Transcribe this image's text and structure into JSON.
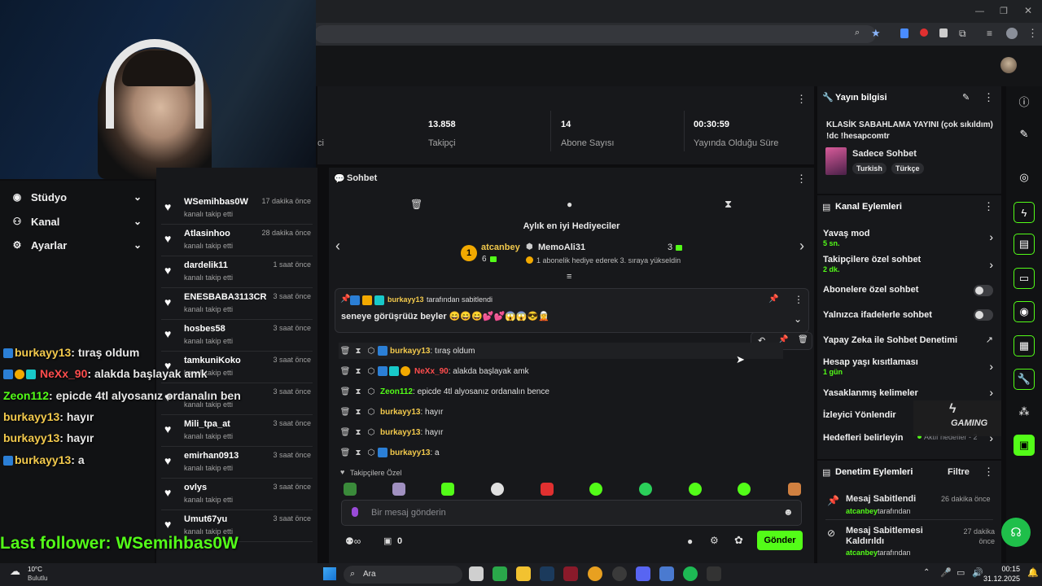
{
  "stats": {
    "followers_num": "13.858",
    "followers_label": "Takipçi",
    "subs_num": "14",
    "subs_label": "Abone Sayısı",
    "uptime_num": "00:30:59",
    "uptime_label": "Yayında Olduğu Süre",
    "partial_label": "ci"
  },
  "left_nav": {
    "items": [
      {
        "label": "Stüdyo"
      },
      {
        "label": "Kanal"
      },
      {
        "label": "Ayarlar"
      }
    ]
  },
  "overlay": {
    "lines": [
      {
        "user": "burkayy13",
        "text": ": tıraş oldum",
        "color": "#f2c94c"
      },
      {
        "user": "NeXx_90",
        "text": ": alakda başlayak amk",
        "color": "#ff4d4d"
      },
      {
        "user": "Zeon112",
        "text": ": epicde 4tl alyosanız ordanalın ben",
        "color": "#53fc18"
      },
      {
        "user": "burkayy13",
        "text": ": hayır",
        "color": "#f2c94c"
      },
      {
        "user": "burkayy13",
        "text": ": hayır",
        "color": "#f2c94c"
      },
      {
        "user": "burkayy13",
        "text": ": a",
        "color": "#f2c94c"
      }
    ],
    "last_follower": "Last follower: WSemihbas0W"
  },
  "followers": {
    "list": [
      {
        "name": "WSemihbas0W",
        "time": "17 dakika önce",
        "sub": "kanalı takip etti"
      },
      {
        "name": "Atlasinhoo",
        "time": "28 dakika önce",
        "sub": "kanalı takip etti"
      },
      {
        "name": "dardelik11",
        "time": "1 saat önce",
        "sub": "kanalı takip etti"
      },
      {
        "name": "ENESBABA3113CR",
        "time": "3 saat önce",
        "sub": "kanalı takip etti"
      },
      {
        "name": "hosbes58",
        "time": "3 saat önce",
        "sub": "kanalı takip etti"
      },
      {
        "name": "tamkuniKoko",
        "time": "3 saat önce",
        "sub": "kanalı takip etti"
      },
      {
        "name": "",
        "time": "3 saat önce",
        "sub": "kanalı takip etti"
      },
      {
        "name": "Mili_tpa_at",
        "time": "3 saat önce",
        "sub": "kanalı takip etti"
      },
      {
        "name": "emirhan0913",
        "time": "3 saat önce",
        "sub": "kanalı takip etti"
      },
      {
        "name": "ovlys",
        "time": "3 saat önce",
        "sub": "kanalı takip etti"
      },
      {
        "name": "Umut67yu",
        "time": "3 saat önce",
        "sub": "kanalı takip etti"
      }
    ]
  },
  "chat": {
    "title": "Sohbet",
    "gifters_title": "Aylık en iyi Hediyeciler",
    "top_gifter": {
      "rank": "1",
      "name": "atcanbey",
      "count": "6"
    },
    "second": {
      "name": "MemoAli31",
      "count": "3",
      "note": "1 abonelik hediye ederek 3. sıraya yükseldin"
    },
    "pinned": {
      "user": "burkayy13",
      "by": "tarafından sabitlendi",
      "text": "seneye görüşrüüz beyler 😄😄😄💕💕😱😱😎🧝"
    },
    "messages": [
      {
        "user": "burkayy13",
        "text": ": tıraş oldum",
        "color": "#f2c94c"
      },
      {
        "user": "NeXx_90",
        "text": ": alakda başlayak amk",
        "color": "#ff4d4d"
      },
      {
        "user": "Zeon112",
        "text": ": epicde 4tl alyosanız ordanalın bence",
        "color": "#53fc18"
      },
      {
        "user": "burkayy13",
        "text": ": hayır",
        "color": "#f2c94c"
      },
      {
        "user": "burkayy13",
        "text": ": hayır",
        "color": "#f2c94c"
      },
      {
        "user": "burkayy13",
        "text": ": a",
        "color": "#f2c94c"
      }
    ],
    "followers_only": "Takipçilere Özel",
    "input_placeholder": "Bir mesaj gönderin",
    "points": "0",
    "send_label": "Gönder"
  },
  "stream_info": {
    "title": "Yayın bilgisi",
    "stream_title": "KLASİK SABAHLAMA YAYINI (çok sıkıldım) !dc !hesapcomtr",
    "category": "Sadece Sohbet",
    "tags": [
      "Turkish",
      "Türkçe"
    ]
  },
  "channel_actions": {
    "title": "Kanal Eylemleri",
    "slow_mode": "Yavaş mod",
    "slow_mode_val": "5 sn.",
    "followers_chat": "Takipçilere özel sohbet",
    "followers_chat_val": "2 dk.",
    "subs_chat": "Abonelere özel sohbet",
    "emote_chat": "Yalnızca ifadelerle sohbet",
    "ai_mod": "Yapay Zeka ile Sohbet Denetimi",
    "age_restrict": "Hesap yaşı kısıtlaması",
    "age_restrict_val": "1 gün",
    "banned_words": "Yasaklanmış kelimeler",
    "viewer_redirect": "İzleyici Yönlendir",
    "goals": "Hedefleri belirleyin",
    "goals_val": "Aktif hedefler - 2",
    "watermark": "GAMING"
  },
  "mod_actions": {
    "title": "Denetim Eylemleri",
    "filter": "Filtre",
    "items": [
      {
        "title": "Mesaj Sabitlendi",
        "user": "atcanbey",
        "by": "tarafından",
        "time": "26 dakika önce"
      },
      {
        "title": "Mesaj Sabitlemesi Kaldırıldı",
        "user": "atcanbey",
        "by": "tarafından",
        "time": "27 dakika önce"
      }
    ]
  },
  "taskbar": {
    "temp": "10°C",
    "weather": "Bulutlu",
    "search": "Ara",
    "time": "00:15",
    "date": "31.12.2025"
  },
  "colors": {
    "accent": "#53fc18",
    "panel": "#17181b",
    "bg": "#0d0d0f"
  }
}
